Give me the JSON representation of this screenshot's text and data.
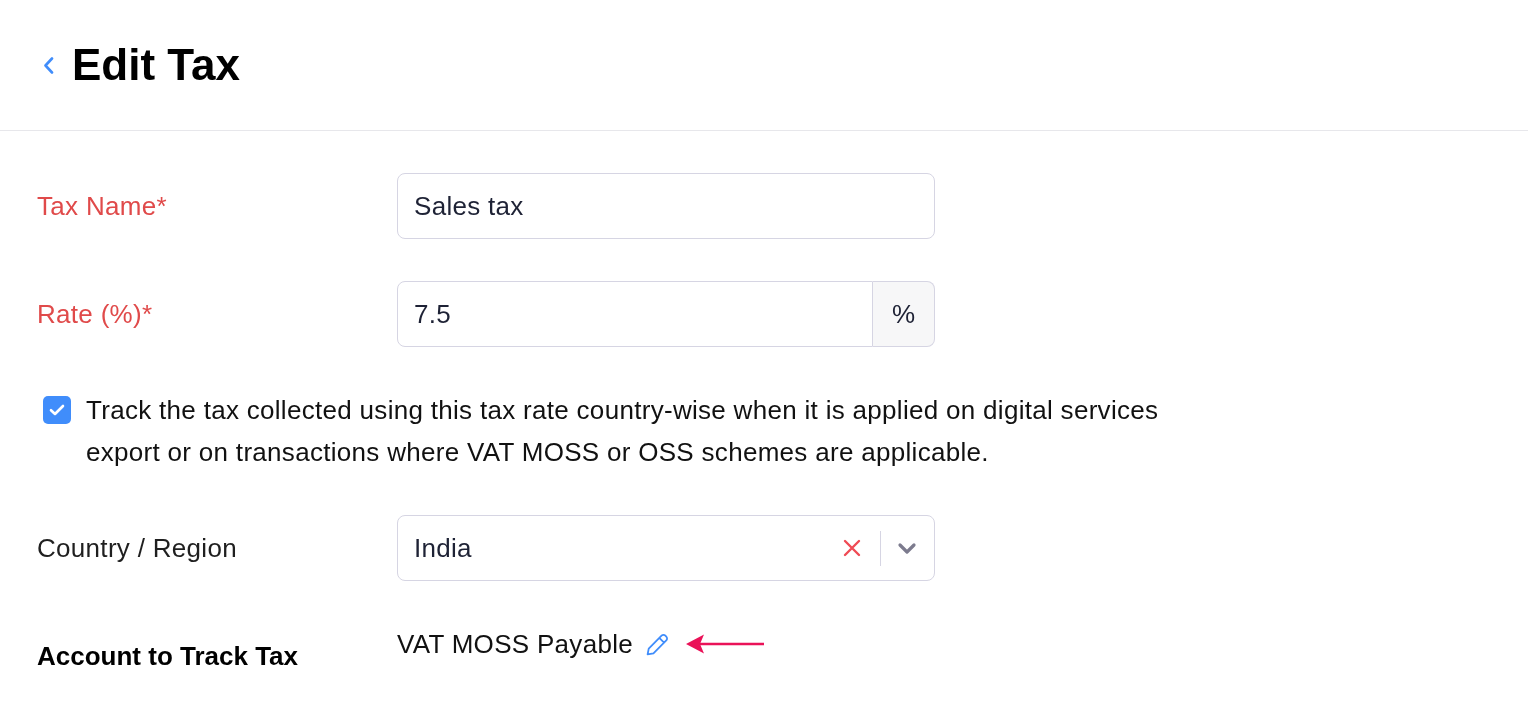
{
  "header": {
    "title": "Edit Tax"
  },
  "rows": [
    {
      "kind": "text",
      "label": "Tax Name*",
      "required": true,
      "value": "Sales tax"
    },
    {
      "kind": "percent",
      "label": "Rate (%)*",
      "required": true,
      "value": "7.5",
      "suffix": "%"
    },
    {
      "kind": "checkbox",
      "checked": true,
      "label": "Track the tax collected using this tax rate country-wise when it is applied on digital services export or on transactions where VAT MOSS or OSS schemes are applicable."
    },
    {
      "kind": "select",
      "label": "Country / Region",
      "required": false,
      "value": "India"
    },
    {
      "kind": "account",
      "label": "Account to Track Tax",
      "required": false,
      "value": "VAT MOSS Payable"
    }
  ]
}
